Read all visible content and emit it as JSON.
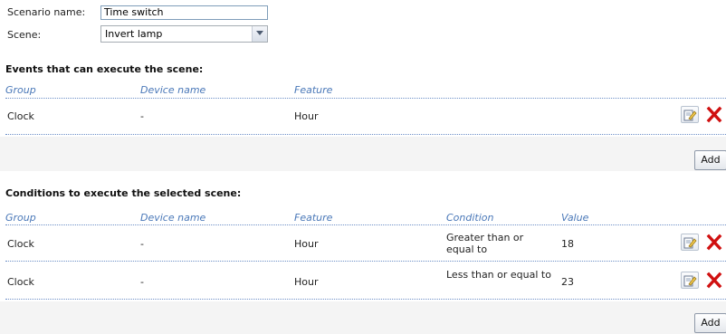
{
  "form": {
    "scenario_name_label": "Scenario name:",
    "scenario_name_value": "Time switch",
    "scene_label": "Scene:",
    "scene_value": "Invert lamp"
  },
  "events": {
    "title": "Events that can execute the scene:",
    "columns": [
      "Group",
      "Device name",
      "Feature"
    ],
    "rows": [
      {
        "group": "Clock",
        "device": "-",
        "feature": "Hour"
      }
    ],
    "add_label": "Add"
  },
  "conditions": {
    "title": "Conditions to execute the selected scene:",
    "columns": [
      "Group",
      "Device name",
      "Feature",
      "Condition",
      "Value"
    ],
    "rows": [
      {
        "group": "Clock",
        "device": "-",
        "feature": "Hour",
        "condition": "Greater than or equal to",
        "value": "18"
      },
      {
        "group": "Clock",
        "device": "-",
        "feature": "Hour",
        "condition": "Less than or equal to",
        "value": "23"
      }
    ],
    "add_label": "Add"
  },
  "icons": {
    "edit": "edit-icon",
    "delete": "delete-icon",
    "dropdown": "chevron-down-icon"
  },
  "colors": {
    "header_text": "#4a78b8",
    "delete_red": "#d01010",
    "band": "#f4f4f4"
  }
}
